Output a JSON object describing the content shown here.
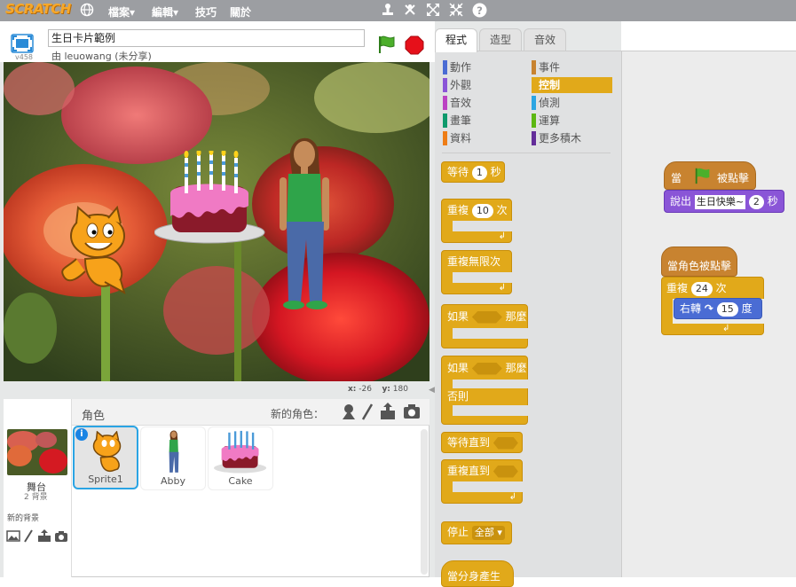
{
  "menubar": {
    "logo": "SCRATCH",
    "items": [
      {
        "label": "檔案▾"
      },
      {
        "label": "編輯▾"
      },
      {
        "label": "技巧"
      },
      {
        "label": "關於"
      }
    ]
  },
  "project": {
    "title": "生日卡片範例",
    "author": "由 leuowang (未分享)",
    "version": "v458"
  },
  "stage": {
    "x_label": "x:",
    "x_value": "-26",
    "y_label": "y:",
    "y_value": "180"
  },
  "sprites_header": {
    "title": "角色",
    "new_sprite": "新的角色："
  },
  "stage_tile": {
    "name": "舞台",
    "backdrops": "2 背景",
    "new_backdrop": "新的背景"
  },
  "sprites": [
    {
      "name": "Sprite1"
    },
    {
      "name": "Abby"
    },
    {
      "name": "Cake"
    }
  ],
  "tabs": [
    {
      "label": "程式"
    },
    {
      "label": "造型"
    },
    {
      "label": "音效"
    }
  ],
  "categories": [
    {
      "label": "動作",
      "color": "#4a6cd4"
    },
    {
      "label": "事件",
      "color": "#c88330"
    },
    {
      "label": "外觀",
      "color": "#8a55d7"
    },
    {
      "label": "控制",
      "color": "#e1a91a"
    },
    {
      "label": "音效",
      "color": "#bb42c3"
    },
    {
      "label": "偵測",
      "color": "#2ca5e2"
    },
    {
      "label": "畫筆",
      "color": "#0e9a6c"
    },
    {
      "label": "運算",
      "color": "#5cb712"
    },
    {
      "label": "資料",
      "color": "#ee7d16"
    },
    {
      "label": "更多積木",
      "color": "#632d99"
    }
  ],
  "palette_blocks": {
    "wait": "等待",
    "wait_val": "1",
    "wait_unit": "秒",
    "repeat": "重複",
    "repeat_val": "10",
    "repeat_unit": "次",
    "forever": "重複無限次",
    "if": "如果",
    "then": "那麼",
    "if2": "如果",
    "then2": "那麼",
    "else": "否則",
    "wait_until": "等待直到",
    "repeat_until": "重複直到",
    "stop": "停止",
    "stop_val": "全部",
    "clone_start": "當分身產生"
  },
  "script1": {
    "when": "當",
    "clicked": "被點擊",
    "say": "說出",
    "say_text": "生日快樂~",
    "say_secs": "2",
    "say_unit": "秒"
  },
  "script2": {
    "when_sprite_clicked": "當角色被點擊",
    "repeat": "重複",
    "repeat_val": "24",
    "repeat_unit": "次",
    "turn": "右轉",
    "turn_val": "15",
    "turn_unit": "度"
  }
}
